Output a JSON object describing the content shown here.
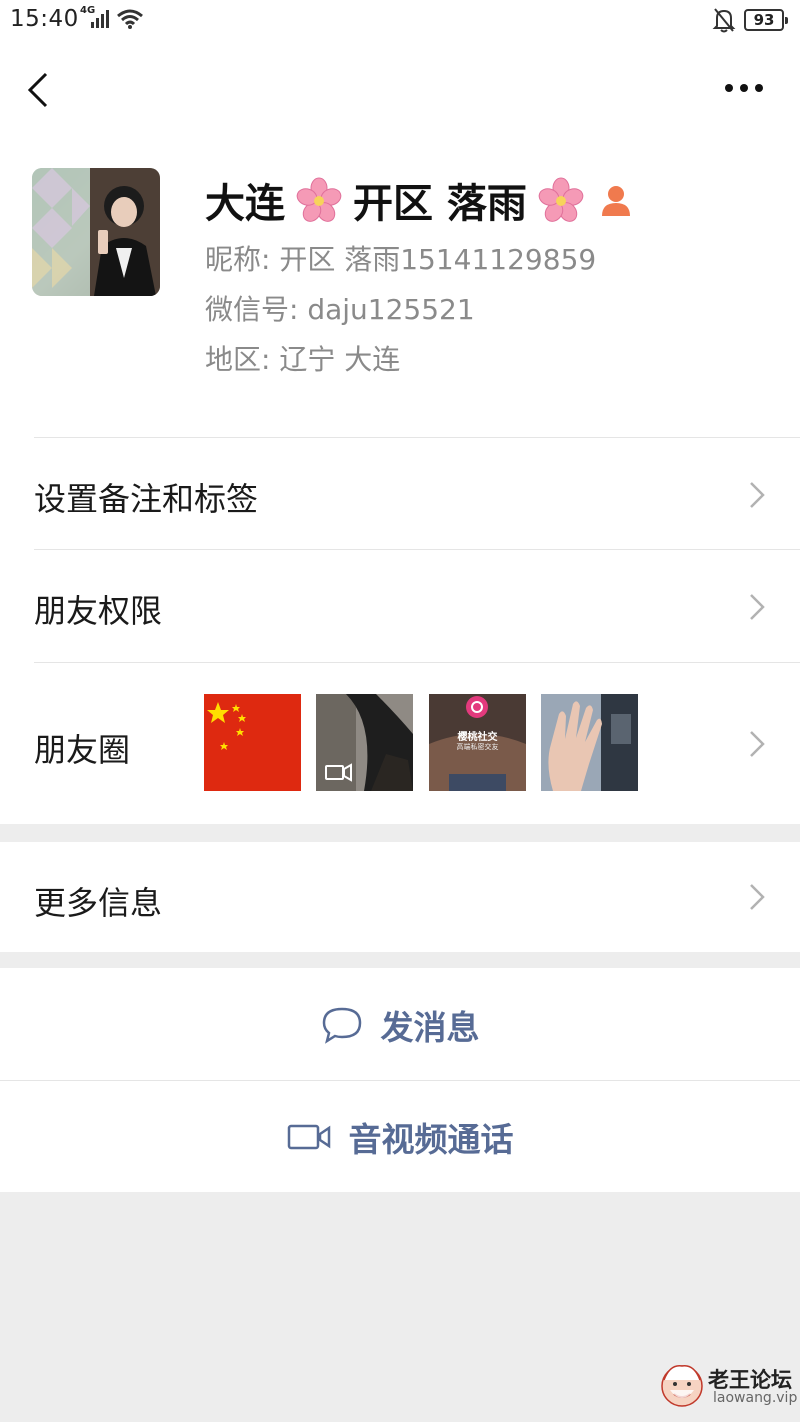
{
  "status_bar": {
    "time": "15:40",
    "network": "4G",
    "battery": "93"
  },
  "profile": {
    "name_part1": "大连",
    "name_part2": "开区 落雨",
    "nickname": "昵称: 开区 落雨15141129859",
    "wechat_id": "微信号: daju125521",
    "region": "地区: 辽宁 大连",
    "icons": [
      "cherry-blossom-icon",
      "cherry-blossom-icon",
      "female-icon"
    ]
  },
  "menu": {
    "remark_tags": "设置备注和标签",
    "friend_permissions": "朋友权限",
    "moments": "朋友圈",
    "more_info": "更多信息"
  },
  "moments_thumbs": [
    {
      "type": "flag",
      "icon": "china-flag-icon"
    },
    {
      "type": "video",
      "icon": "video-thumbnail-icon"
    },
    {
      "type": "photo",
      "caption": "樱桃社交",
      "subcaption": "高端私密交友"
    },
    {
      "type": "photo",
      "icon": "hand-photo-icon"
    }
  ],
  "actions": {
    "send_message": "发消息",
    "video_call": "音视频通话"
  },
  "watermark": {
    "title": "老王论坛",
    "url": "laowang.vip"
  },
  "colors": {
    "link_blue": "#576b95",
    "secondary_text": "#8a8a8a",
    "background": "#ededed"
  }
}
